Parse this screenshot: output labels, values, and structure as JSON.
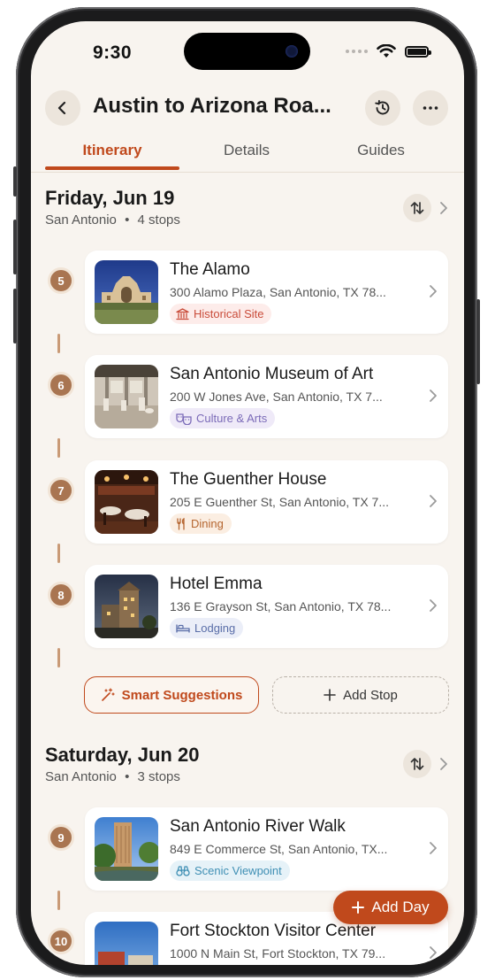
{
  "status": {
    "time": "9:30"
  },
  "header": {
    "title": "Austin to Arizona Roa..."
  },
  "tabs": [
    {
      "label": "Itinerary",
      "active": true
    },
    {
      "label": "Details",
      "active": false
    },
    {
      "label": "Guides",
      "active": false
    }
  ],
  "days": [
    {
      "title": "Friday, Jun 19",
      "city": "San Antonio",
      "stops_label": "4 stops",
      "stops": [
        {
          "number": "5",
          "name": "The Alamo",
          "address": "300 Alamo Plaza, San Antonio, TX 78...",
          "category": "Historical Site",
          "icon": "museum-icon"
        },
        {
          "number": "6",
          "name": "San Antonio Museum of Art",
          "address": "200 W Jones Ave, San Antonio, TX 7...",
          "category": "Culture & Arts",
          "icon": "theater-masks-icon"
        },
        {
          "number": "7",
          "name": "The Guenther House",
          "address": "205 E Guenther St, San Antonio, TX 7...",
          "category": "Dining",
          "icon": "fork-knife-icon"
        },
        {
          "number": "8",
          "name": "Hotel Emma",
          "address": "136 E Grayson St, San Antonio, TX 78...",
          "category": "Lodging",
          "icon": "bed-icon"
        }
      ]
    },
    {
      "title": "Saturday, Jun 20",
      "city": "San Antonio",
      "stops_label": "3 stops",
      "stops": [
        {
          "number": "9",
          "name": "San Antonio River Walk",
          "address": "849 E Commerce St, San Antonio, TX...",
          "category": "Scenic Viewpoint",
          "icon": "binoculars-icon"
        },
        {
          "number": "10",
          "name": "Fort Stockton Visitor Center",
          "address": "1000 N Main St, Fort Stockton, TX 79...",
          "category": "",
          "icon": ""
        }
      ]
    }
  ],
  "actions": {
    "smart_suggestions": "Smart Suggestions",
    "add_stop": "Add Stop",
    "add_day": "Add Day"
  },
  "colors": {
    "accent": "#c0491c",
    "background": "#f8f4ef",
    "stop_number": "#a97551",
    "historical": "#c94c3a",
    "culture": "#7b6bb8",
    "dining": "#b5652f",
    "lodging": "#5a6ea8",
    "scenic": "#3f8fb4"
  }
}
